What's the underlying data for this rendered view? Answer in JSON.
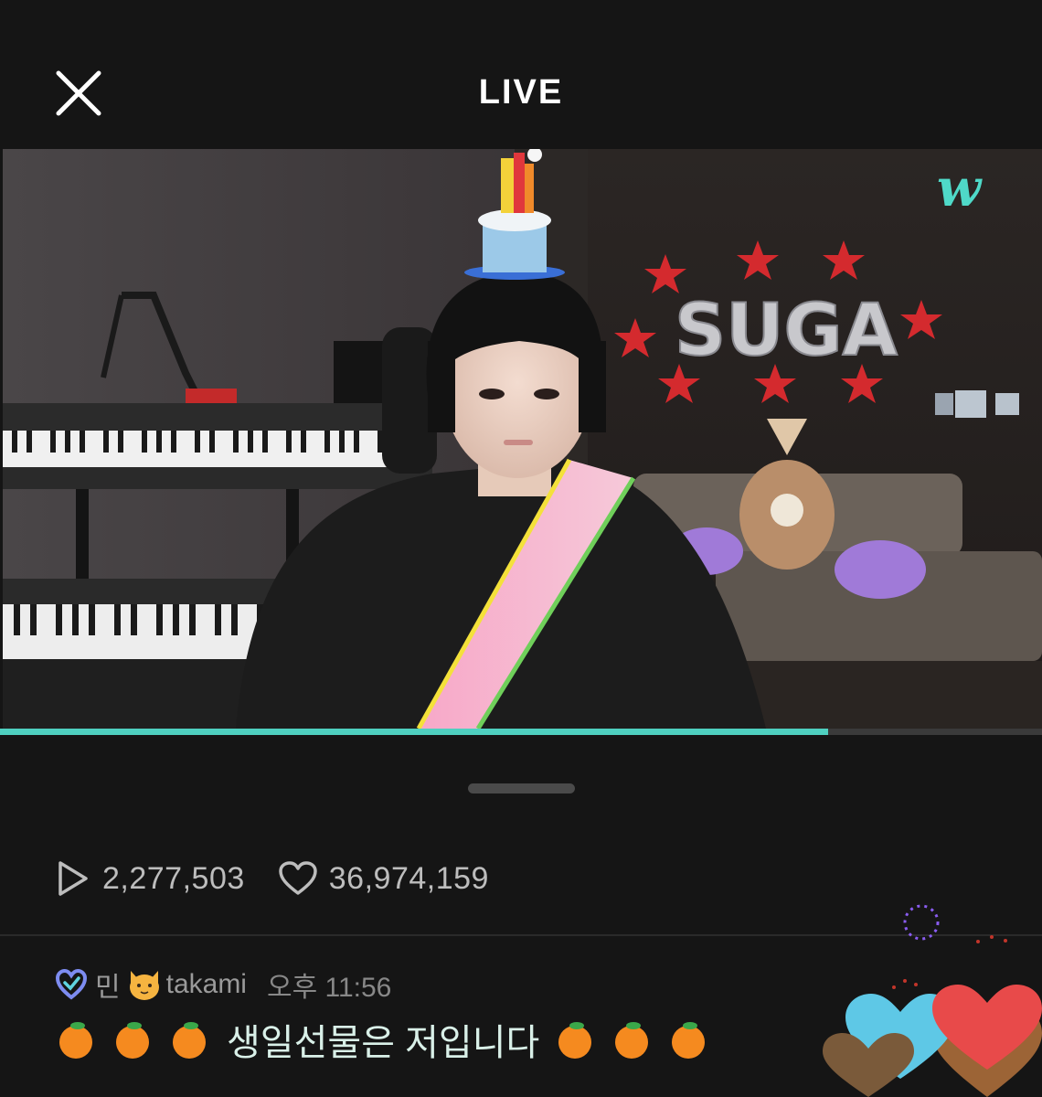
{
  "header": {
    "title": "LIVE"
  },
  "video": {
    "watermark": "w",
    "balloon_letters": "SUGA",
    "progress_fraction": 0.795
  },
  "stats": {
    "plays": "2,277,503",
    "likes": "36,974,159"
  },
  "comment": {
    "username_prefix": "민",
    "username": "takami",
    "time": "오후 11:56",
    "message": "생일선물은 저입니다",
    "emoji": "orange"
  },
  "colors": {
    "accent": "#4fd0c0",
    "background": "#151515"
  }
}
